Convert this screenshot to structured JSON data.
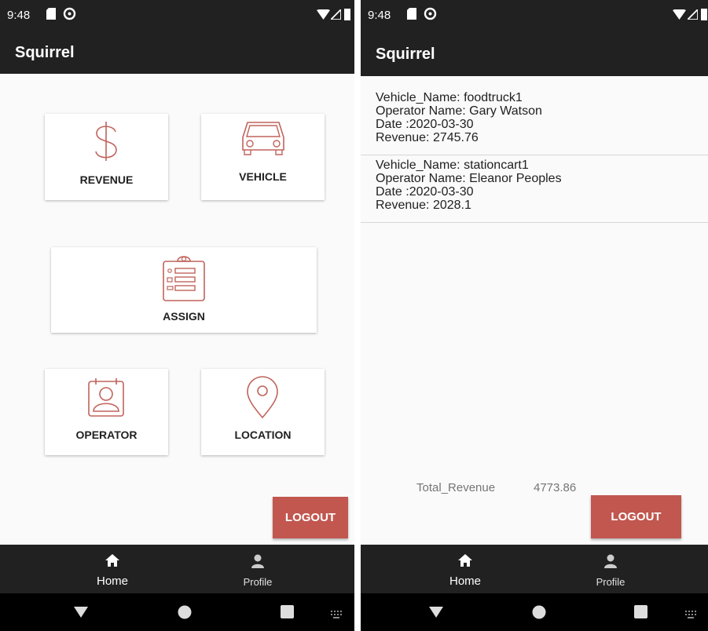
{
  "status": {
    "time": "9:48"
  },
  "app": {
    "title": "Squirrel"
  },
  "home": {
    "cards": {
      "revenue": "REVENUE",
      "vehicle": "VEHICLE",
      "assign": "ASSIGN",
      "operator": "OPERATOR",
      "location": "LOCATION"
    },
    "logout_label": "LOGOUT"
  },
  "revenue_screen": {
    "entries": [
      {
        "vehicle": "Vehicle_Name: foodtruck1",
        "operator": "Operator Name: Gary Watson",
        "date": "Date :2020-03-30",
        "revenue": "Revenue: 2745.76"
      },
      {
        "vehicle": "Vehicle_Name: stationcart1",
        "operator": "Operator Name: Eleanor Peoples",
        "date": "Date :2020-03-30",
        "revenue": "Revenue: 2028.1"
      }
    ],
    "total_label": "Total_Revenue",
    "total_value": "4773.86",
    "logout_label": "LOGOUT"
  },
  "bottom_nav": {
    "home": "Home",
    "profile": "Profile"
  },
  "colors": {
    "accent": "#c1574f",
    "bar": "#212121",
    "background": "#fafafa",
    "icon_stroke": "#c0635b"
  },
  "icons": [
    "dollar-icon",
    "car-icon",
    "clipboard-icon",
    "id-badge-icon",
    "map-pin-icon",
    "home-icon",
    "person-icon",
    "back-icon",
    "home-circle-icon",
    "recents-icon",
    "keyboard-icon",
    "sd-card-icon",
    "sync-icon",
    "wifi-icon",
    "signal-icon",
    "battery-icon"
  ]
}
